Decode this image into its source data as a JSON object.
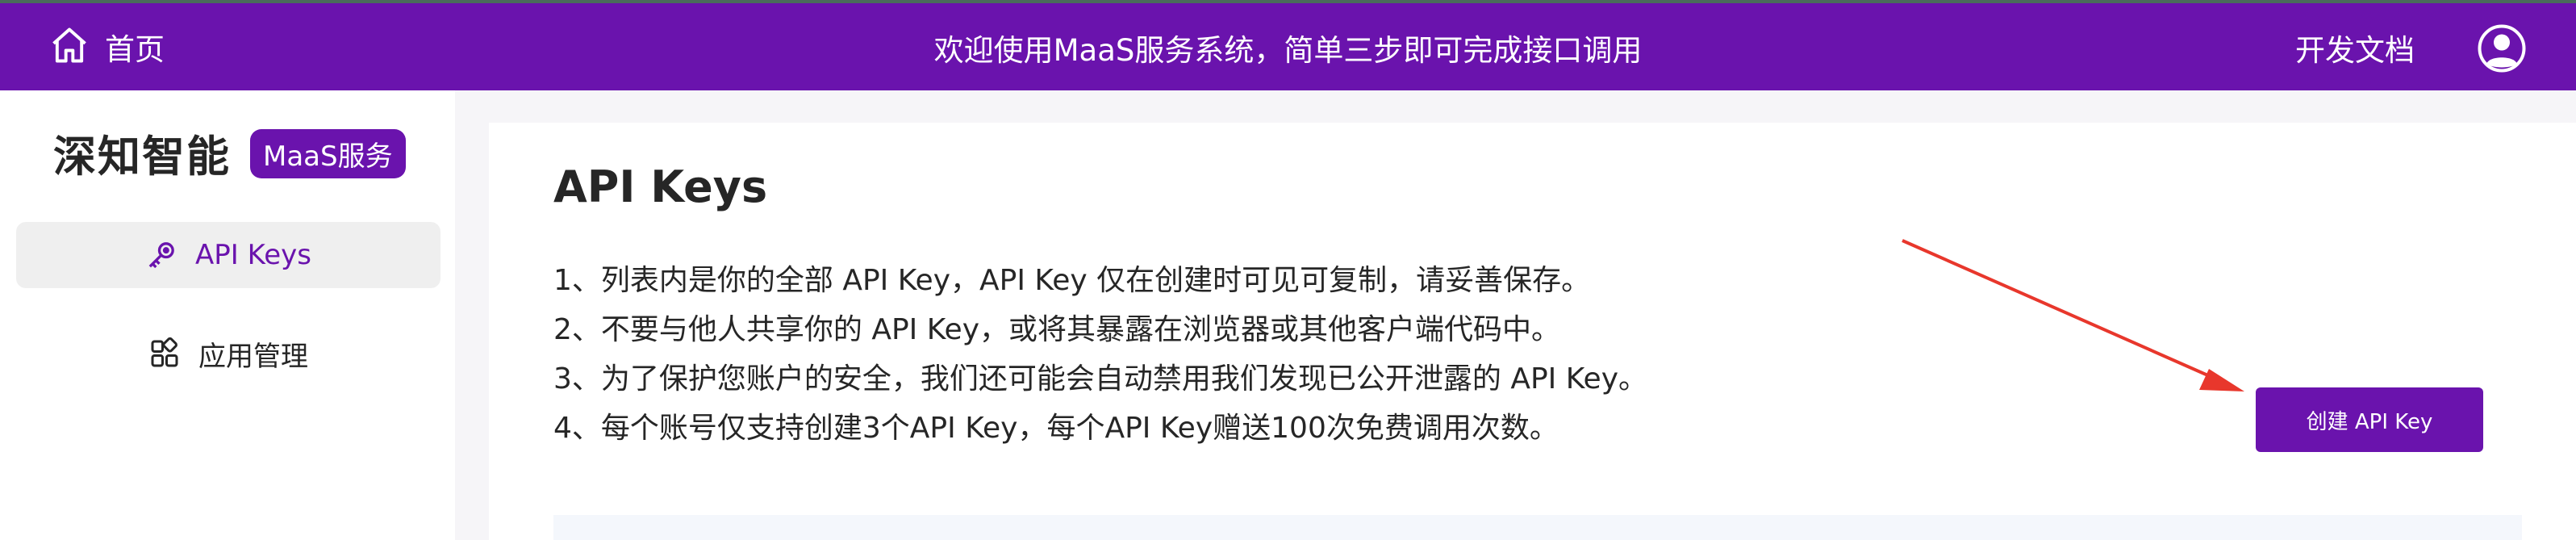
{
  "topbar": {
    "home_label": "首页",
    "banner": "欢迎使用MaaS服务系统，简单三步即可完成接口调用",
    "docs_label": "开发文档"
  },
  "sidebar": {
    "brand_name": "深知智能",
    "brand_badge": "MaaS服务",
    "items": [
      {
        "label": "API Keys",
        "icon": "key-icon",
        "active": true
      },
      {
        "label": "应用管理",
        "icon": "grid-icon",
        "active": false
      }
    ]
  },
  "main": {
    "title": "API Keys",
    "notes": [
      "1、列表内是你的全部 API Key，API Key 仅在创建时可见可复制，请妥善保存。",
      "2、不要与他人共享你的 API Key，或将其暴露在浏览器或其他客户端代码中。",
      "3、为了保护您账户的安全，我们还可能会自动禁用我们发现已公开泄露的 API Key。",
      "4、每个账号仅支持创建3个API Key，每个API Key赠送100次免费调用次数。"
    ],
    "create_button": "创建 API Key"
  },
  "colors": {
    "brand": "#6a13ad",
    "annotation_arrow": "#e8372c"
  }
}
